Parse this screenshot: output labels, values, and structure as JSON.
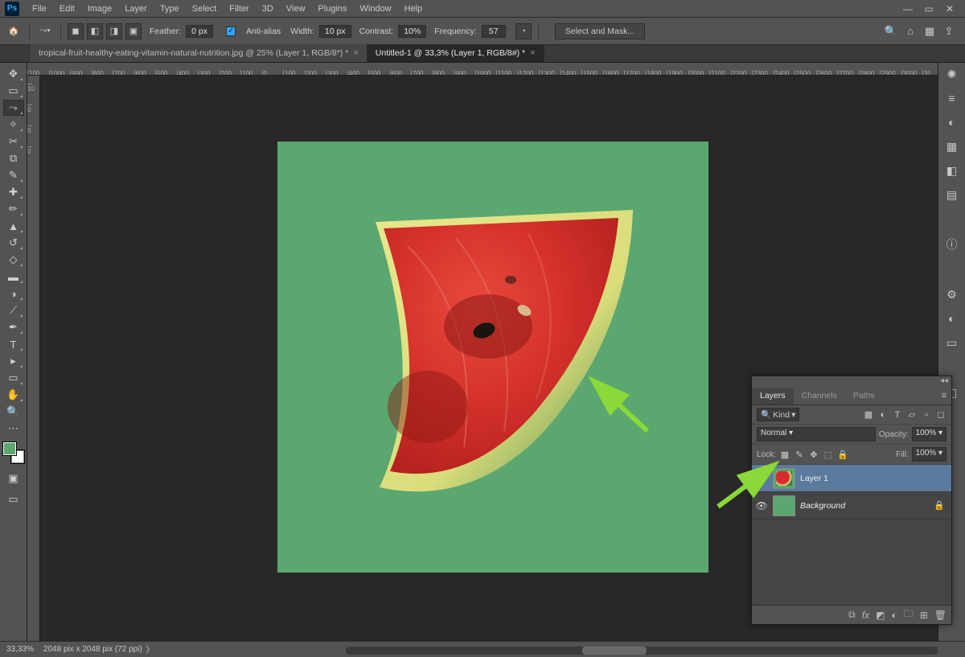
{
  "menu": {
    "items": [
      "File",
      "Edit",
      "Image",
      "Layer",
      "Type",
      "Select",
      "Filter",
      "3D",
      "View",
      "Plugins",
      "Window",
      "Help"
    ]
  },
  "window_controls": {
    "min": "—",
    "max": "▭",
    "close": "✕"
  },
  "options": {
    "feather_label": "Feather:",
    "feather_value": "0 px",
    "antialias_label": "Anti-alias",
    "width_label": "Width:",
    "width_value": "10 px",
    "contrast_label": "Contrast:",
    "contrast_value": "10%",
    "frequency_label": "Frequency:",
    "frequency_value": "57",
    "select_mask": "Select and Mask..."
  },
  "tabs": {
    "tab1": "tropical-fruit-healthy-eating-vitamin-natural-nutrition.jpg @ 25% (Layer 1, RGB/8*) *",
    "tab2": "Untitled-1 @ 33,3% (Layer 1, RGB/8#) *"
  },
  "tools_list": [
    "↔",
    "▧",
    "⤳",
    "✧",
    "✂",
    "⧉",
    "⌀",
    "✎",
    "⟆",
    "▲",
    "⧓",
    "◊",
    "✒",
    "◯",
    "T",
    "▶",
    "☝",
    "▭",
    "⊕",
    "⌕",
    "⋯"
  ],
  "ruler_marks": [
    "100",
    "1000",
    "900",
    "800",
    "700",
    "600",
    "500",
    "400",
    "300",
    "200",
    "100",
    "0",
    "100",
    "200",
    "300",
    "400",
    "500",
    "600",
    "700",
    "800",
    "900",
    "1000",
    "1100",
    "1200",
    "1300",
    "1400",
    "1500",
    "1600",
    "1700",
    "1800",
    "1900",
    "2000",
    "2100",
    "2200",
    "2300",
    "2400",
    "2500",
    "2600",
    "2700",
    "2800",
    "2900",
    "3000",
    "31"
  ],
  "ruler_v": [
    "10",
    "0",
    "0",
    "0"
  ],
  "layers_panel": {
    "tabs": {
      "layers": "Layers",
      "channels": "Channels",
      "paths": "Paths"
    },
    "kind_label": "Kind",
    "blend_mode": "Normal",
    "opacity_label": "Opacity:",
    "opacity_value": "100%",
    "lock_label": "Lock:",
    "fill_label": "Fill:",
    "fill_value": "100%",
    "layer1_name": "Layer 1",
    "background_name": "Background"
  },
  "status": {
    "zoom": "33,33%",
    "doc_info": "2048 pix x 2048 pix (72 ppi)"
  },
  "colors": {
    "canvas_bg": "#5aa770",
    "accent": "#31a8ff",
    "arrow": "#8bd938"
  }
}
